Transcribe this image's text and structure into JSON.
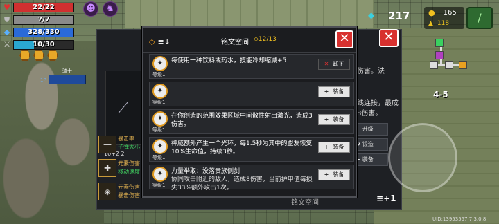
{
  "status": {
    "hp": {
      "text": "22/22",
      "fill": 1.0,
      "color": "#d03030"
    },
    "armor": {
      "text": "7/7",
      "fill": 1.0,
      "color": "#8a8a8a"
    },
    "energy": {
      "text": "328/330",
      "fill": 0.994,
      "color": "#2a6ad8"
    },
    "skill": {
      "text": "10/30",
      "fill": 0.333,
      "color": "#2aa8d0"
    }
  },
  "hud": {
    "energy_value": "217",
    "coins": "165",
    "gems": "118"
  },
  "minimap": {
    "stage": "4-5"
  },
  "weapon_panel": {
    "stat_text": "10+2 2",
    "right_text_1": "伤害。法",
    "right_text_2": "线连接，最成8伤害。",
    "upgrade_label": "升级",
    "craft_label": "锻造",
    "equip_label": "装备",
    "footer_text": "铭文空间",
    "footer_btn": "+1",
    "side_1": "暴击率",
    "side_1b": "子弹大小",
    "side_2": "元素伤害",
    "side_2b": "移动速度",
    "side_3": "元素伤害",
    "side_3b": "暴击伤害"
  },
  "uid": "UID:13953557 7.3.0.8",
  "modal": {
    "title": "铭文空间",
    "count": "12/13",
    "items": [
      {
        "desc": "每使用一种饮料或药水，技能冷却缩减+5",
        "sub": "",
        "level": "等级1",
        "button": "卸下",
        "equipped": true
      },
      {
        "desc": "",
        "sub": "",
        "level": "等级1",
        "button": "装备",
        "equipped": false
      },
      {
        "desc": "在你创造的范围效果区域中间散性射出激光，造成3伤害。",
        "sub": "",
        "level": "等级1",
        "button": "装备",
        "equipped": false
      },
      {
        "desc": "神威额外产生一个光环，每1.5秒为其中的盟友恢复10%生命值，持续3秒。",
        "sub": "",
        "level": "等级1",
        "button": "装备",
        "equipped": false
      },
      {
        "desc": "力量举取：没落贵族侧剑",
        "sub": "协同攻击附近的敌人，造成8伤害，当前护甲值每损失33%额外攻击1次。",
        "level": "等级1",
        "button": "装备",
        "equipped": false
      }
    ]
  },
  "icons": {
    "hp": "heart-icon",
    "armor": "shield-icon",
    "energy": "diamond-icon",
    "skill": "sword-icon",
    "close": "close-icon",
    "sort": "sort-icon"
  }
}
